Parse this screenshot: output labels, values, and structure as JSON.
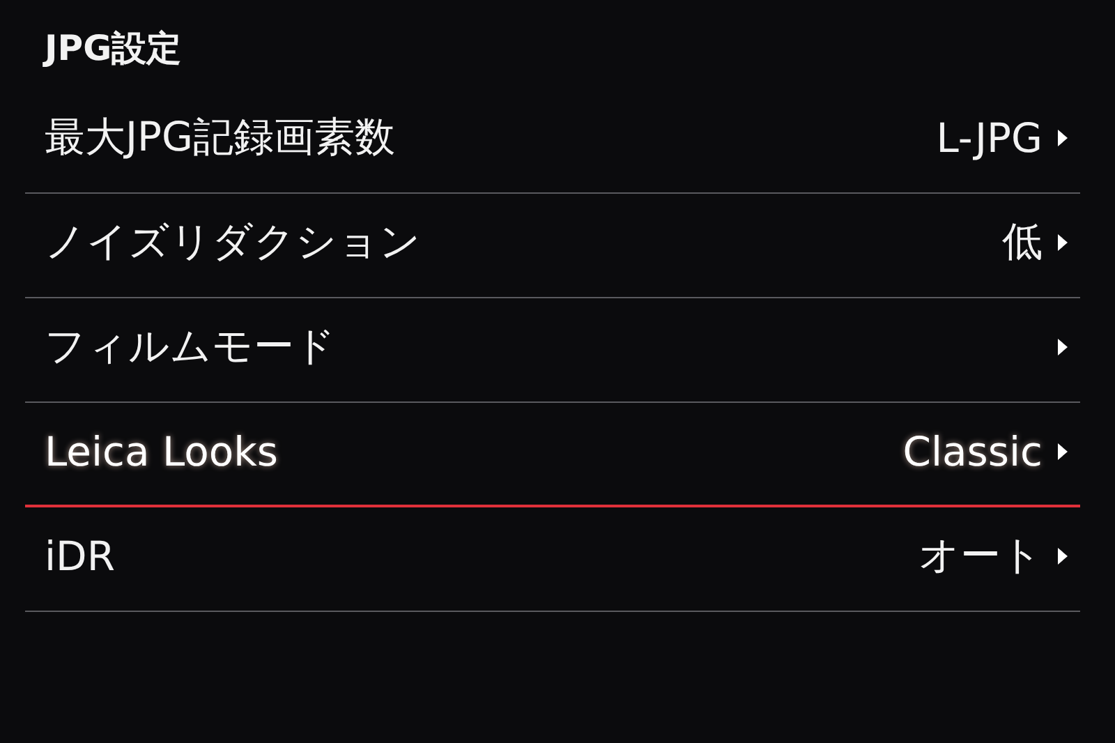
{
  "title": "JPG設定",
  "items": [
    {
      "label": "最大JPG記録画素数",
      "value": "L-JPG",
      "selected": false
    },
    {
      "label": "ノイズリダクション",
      "value": "低",
      "selected": false
    },
    {
      "label": "フィルムモード",
      "selected": false
    },
    {
      "label": "Leica Looks",
      "value": "Classic",
      "selected": true
    },
    {
      "label": "iDR",
      "value": "オート",
      "selected": false
    }
  ]
}
